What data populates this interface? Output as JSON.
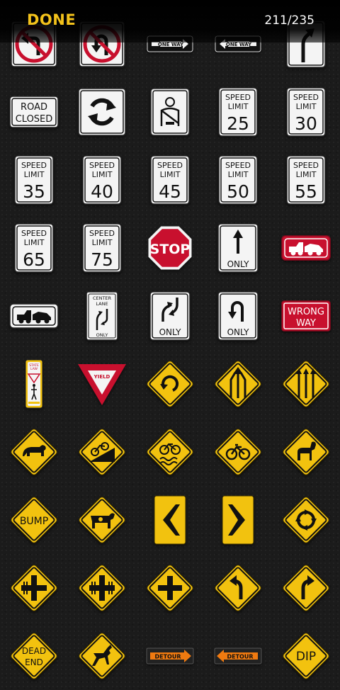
{
  "header": {
    "done_label": "DONE",
    "progress": "211/235"
  },
  "colors": {
    "accent": "#f3c21b",
    "sign_yellow": "#f2c20f",
    "sign_red": "#c8102e",
    "sign_orange": "#f07a10"
  },
  "signs": [
    {
      "name": "no-left-turn-sign-icon",
      "kind": "prohibit",
      "symbol": "left-turn"
    },
    {
      "name": "no-u-turn-sign-icon",
      "kind": "prohibit",
      "symbol": "u-turn"
    },
    {
      "name": "one-way-left-sign-icon",
      "kind": "oneway",
      "text": "ONE WAY",
      "dir": "left"
    },
    {
      "name": "one-way-right-sign-icon",
      "kind": "oneway",
      "text": "ONE WAY",
      "dir": "right"
    },
    {
      "name": "right-turn-arrow-sign-icon",
      "kind": "arrow",
      "symbol": "right-up"
    },
    {
      "name": "road-closed-sign-icon",
      "kind": "textw",
      "lines": [
        "ROAD",
        "CLOSED"
      ]
    },
    {
      "name": "roundabout-sign-icon",
      "kind": "arrow",
      "symbol": "roundabout"
    },
    {
      "name": "seatbelt-sign-icon",
      "kind": "arrow",
      "symbol": "seatbelt"
    },
    {
      "name": "speed-limit-25-sign-icon",
      "kind": "speed",
      "lines": [
        "SPEED",
        "LIMIT",
        "25"
      ]
    },
    {
      "name": "speed-limit-30-sign-icon",
      "kind": "speed",
      "lines": [
        "SPEED",
        "LIMIT",
        "30"
      ]
    },
    {
      "name": "speed-limit-35-sign-icon",
      "kind": "speed",
      "lines": [
        "SPEED",
        "LIMIT",
        "35"
      ]
    },
    {
      "name": "speed-limit-40-sign-icon",
      "kind": "speed",
      "lines": [
        "SPEED",
        "LIMIT",
        "40"
      ]
    },
    {
      "name": "speed-limit-45-sign-icon",
      "kind": "speed",
      "lines": [
        "SPEED",
        "LIMIT",
        "45"
      ]
    },
    {
      "name": "speed-limit-50-sign-icon",
      "kind": "speed",
      "lines": [
        "SPEED",
        "LIMIT",
        "50"
      ]
    },
    {
      "name": "speed-limit-55-sign-icon",
      "kind": "speed",
      "lines": [
        "SPEED",
        "LIMIT",
        "55"
      ]
    },
    {
      "name": "speed-limit-65-sign-icon",
      "kind": "speed",
      "lines": [
        "SPEED",
        "LIMIT",
        "65"
      ]
    },
    {
      "name": "speed-limit-75-sign-icon",
      "kind": "speed",
      "lines": [
        "SPEED",
        "LIMIT",
        "75"
      ]
    },
    {
      "name": "stop-sign-icon",
      "kind": "stop",
      "text": "STOP"
    },
    {
      "name": "straight-only-sign-icon",
      "kind": "only",
      "text": "ONLY",
      "symbol": "straight"
    },
    {
      "name": "tow-away-red-sign-icon",
      "kind": "tow",
      "variant": "red"
    },
    {
      "name": "tow-away-white-sign-icon",
      "kind": "tow",
      "variant": "white"
    },
    {
      "name": "center-lane-only-sign-icon",
      "kind": "center",
      "lines": [
        "CENTER",
        "LANE",
        "ONLY"
      ]
    },
    {
      "name": "two-way-left-turn-only-sign-icon",
      "kind": "only",
      "text": "ONLY",
      "symbol": "two-way"
    },
    {
      "name": "u-turn-only-sign-icon",
      "kind": "only",
      "text": "ONLY",
      "symbol": "u-turn"
    },
    {
      "name": "wrong-way-sign-icon",
      "kind": "wrong",
      "lines": [
        "WRONG",
        "WAY"
      ]
    },
    {
      "name": "pedestrian-state-law-sign-icon",
      "kind": "ped",
      "lines": [
        "STATE",
        "LAW"
      ]
    },
    {
      "name": "yield-sign-icon",
      "kind": "yield",
      "text": "YIELD"
    },
    {
      "name": "roundabout-warning-sign-icon",
      "kind": "diamond",
      "symbol": "circle-arrow"
    },
    {
      "name": "merge-lanes-warning-sign-icon",
      "kind": "diamond",
      "symbol": "lanes-merge"
    },
    {
      "name": "added-lane-warning-sign-icon",
      "kind": "diamond",
      "symbol": "lanes-add"
    },
    {
      "name": "bear-crossing-sign-icon",
      "kind": "diamond",
      "symbol": "bear"
    },
    {
      "name": "bicycle-hill-sign-icon",
      "kind": "diamond",
      "symbol": "bike-hill"
    },
    {
      "name": "bicycle-slippery-sign-icon",
      "kind": "diamond",
      "symbol": "bike-slip"
    },
    {
      "name": "bicycle-crossing-sign-icon",
      "kind": "diamond",
      "symbol": "bike"
    },
    {
      "name": "bighorn-sheep-crossing-sign-icon",
      "kind": "diamond",
      "symbol": "sheep"
    },
    {
      "name": "bump-warning-sign-icon",
      "kind": "diamond",
      "text": "BUMP"
    },
    {
      "name": "cattle-crossing-sign-icon",
      "kind": "diamond",
      "symbol": "cow"
    },
    {
      "name": "chevron-left-sign-icon",
      "kind": "chevron",
      "dir": "left"
    },
    {
      "name": "chevron-right-sign-icon",
      "kind": "chevron",
      "dir": "right"
    },
    {
      "name": "circular-intersection-sign-icon",
      "kind": "diamond",
      "symbol": "circle-arrows"
    },
    {
      "name": "railroad-cross-left-sign-icon",
      "kind": "diamond",
      "symbol": "rail-left"
    },
    {
      "name": "railroad-cross-both-sign-icon",
      "kind": "diamond",
      "symbol": "rail-both"
    },
    {
      "name": "crossroad-warning-sign-icon",
      "kind": "diamond",
      "symbol": "cross"
    },
    {
      "name": "curve-left-warning-sign-icon",
      "kind": "diamond",
      "symbol": "curve-left"
    },
    {
      "name": "curve-right-warning-sign-icon",
      "kind": "diamond",
      "symbol": "curve-right"
    },
    {
      "name": "dead-end-sign-icon",
      "kind": "diamond",
      "lines": [
        "DEAD",
        "END"
      ]
    },
    {
      "name": "deer-crossing-sign-icon",
      "kind": "diamond",
      "symbol": "deer"
    },
    {
      "name": "detour-left-sign-icon",
      "kind": "detour",
      "text": "DETOUR",
      "dir": "left"
    },
    {
      "name": "detour-right-sign-icon",
      "kind": "detour",
      "text": "DETOUR",
      "dir": "right"
    },
    {
      "name": "dip-warning-sign-icon",
      "kind": "diamond",
      "text": "DIP"
    }
  ]
}
